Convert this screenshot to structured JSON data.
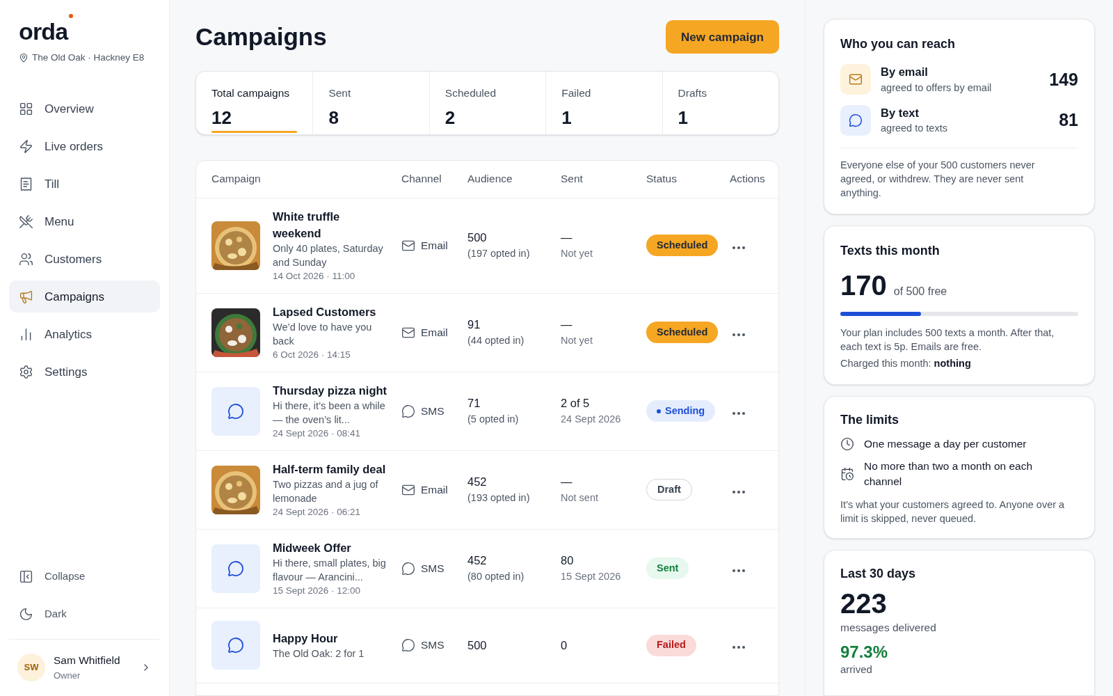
{
  "sidebar": {
    "logo": "orda",
    "location": "The Old Oak · Hackney E8",
    "items": [
      {
        "label": "Overview",
        "selected": false
      },
      {
        "label": "Live orders",
        "selected": false
      },
      {
        "label": "Till",
        "selected": false
      },
      {
        "label": "Menu",
        "selected": false
      },
      {
        "label": "Customers",
        "selected": false
      },
      {
        "label": "Campaigns",
        "selected": true
      },
      {
        "label": "Analytics",
        "selected": false
      },
      {
        "label": "Settings",
        "selected": false
      }
    ],
    "bottom_items": [
      {
        "label": "Collapse"
      },
      {
        "label": "Dark"
      }
    ],
    "user": {
      "initials": "SW",
      "name": "Sam Whitfield",
      "role": "Owner"
    }
  },
  "header": {
    "title": "Campaigns",
    "button": "New campaign"
  },
  "stats": [
    {
      "label": "Total campaigns",
      "value": "12",
      "selected": true
    },
    {
      "label": "Sent",
      "value": "8",
      "selected": false
    },
    {
      "label": "Scheduled",
      "value": "2",
      "selected": false
    },
    {
      "label": "Failed",
      "value": "1",
      "selected": false
    },
    {
      "label": "Drafts",
      "value": "1",
      "selected": false
    }
  ],
  "table": {
    "columns": [
      "Campaign",
      "Channel",
      "Audience",
      "Sent",
      "Status",
      "Actions"
    ],
    "rows": [
      {
        "kind": "picture",
        "name": "White truffle weekend",
        "description": "Only 40 plates, Saturday and Sunday",
        "date": "14 Oct 2026 · 11:00",
        "channel": {
          "label": "Email",
          "kind": "email"
        },
        "audience": "500",
        "opted": "(197 opted in)",
        "sent": "—",
        "sent_note": "Not yet",
        "status": {
          "label": "Scheduled",
          "kind": "scheduled"
        }
      },
      {
        "kind": "picture",
        "name": "Lapsed Customers",
        "description": "We’d love to have you back",
        "date": "6 Oct 2026 · 14:15",
        "channel": {
          "label": "Email",
          "kind": "email"
        },
        "audience": "91",
        "opted": "(44 opted in)",
        "sent": "—",
        "sent_note": "Not yet",
        "status": {
          "label": "Scheduled",
          "kind": "scheduled"
        }
      },
      {
        "kind": "sms",
        "name": "Thursday pizza night",
        "description": "Hi there, it’s been a while — the oven’s lit...",
        "date": "24 Sept 2026 · 08:41",
        "channel": {
          "label": "SMS",
          "kind": "sms"
        },
        "audience": "71",
        "opted": "(5 opted in)",
        "sent": "2 of 5",
        "sent_note": "24 Sept 2026",
        "status": {
          "label": "Sending",
          "kind": "sending"
        }
      },
      {
        "kind": "picture",
        "name": "Half-term family deal",
        "description": "Two pizzas and a jug of lemonade",
        "date": "24 Sept 2026 · 06:21",
        "channel": {
          "label": "Email",
          "kind": "email"
        },
        "audience": "452",
        "opted": "(193 opted in)",
        "sent": "—",
        "sent_note": "Not sent",
        "status": {
          "label": "Draft",
          "kind": "draft"
        }
      },
      {
        "kind": "sms",
        "name": "Midweek Offer",
        "description": "Hi there, small plates, big flavour — Arancini...",
        "date": "15 Sept 2026 · 12:00",
        "channel": {
          "label": "SMS",
          "kind": "sms"
        },
        "audience": "452",
        "opted": "(80 opted in)",
        "sent": "80",
        "sent_note": "15 Sept 2026",
        "status": {
          "label": "Sent",
          "kind": "sent"
        }
      },
      {
        "kind": "sms",
        "name": "Happy Hour",
        "description": "The Old Oak: 2 for 1",
        "channel": {
          "label": "SMS",
          "kind": "sms"
        },
        "audience": "500",
        "sent": "0",
        "status": {
          "label": "Failed",
          "kind": "failed"
        }
      }
    ]
  },
  "reach": {
    "title": "Who you can reach",
    "channels": [
      {
        "kind": "email",
        "label": "By email",
        "note": "agreed to offers by email",
        "count": "149"
      },
      {
        "kind": "sms",
        "label": "By text",
        "note": "agreed to texts",
        "count": "81"
      }
    ],
    "footnote": "Everyone else of your 500 customers never agreed, or withdrew. They are never sent anything."
  },
  "texts": {
    "title": "Texts this month",
    "value": "170",
    "of": "of 500 free",
    "level": 0.34,
    "note": "Your plan includes 500 texts a month. After that, each text is 5p. Emails are free.",
    "charged": "Charged this month: **nothing**"
  },
  "limits": {
    "title": "The limits",
    "items": [
      {
        "kind": "clock",
        "text": "One message a day per customer"
      },
      {
        "kind": "calendar",
        "text": "No more than two a month on each channel"
      }
    ],
    "note": "It’s what your customers agreed to. Anyone over a limit is skipped, never queued."
  },
  "last30": {
    "title": "Last 30 days",
    "value": "223",
    "label": "messages delivered",
    "rate": "97.3%",
    "rate_label": "arrived"
  }
}
